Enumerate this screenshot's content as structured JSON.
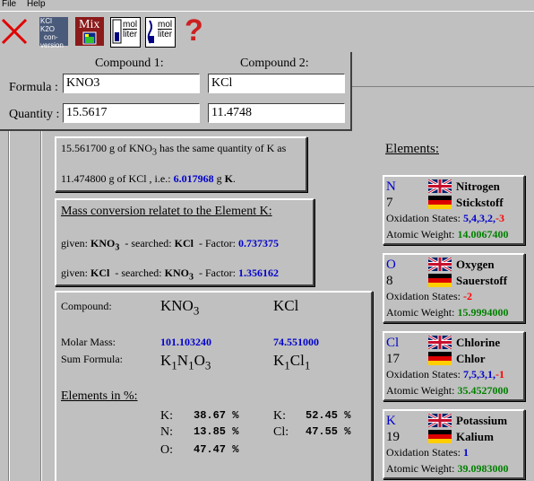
{
  "menu": {
    "file": "File",
    "help": "Help"
  },
  "toolbar": {
    "conversion_line1": "KCl",
    "conversion_line1_b": "K2O",
    "conversion_line2": "con-",
    "conversion_line3": "version",
    "mix_label": "Mix",
    "mol_label_1": "mol",
    "liter_label_1": "liter",
    "mol_label_2": "mol",
    "liter_label_2": "liter",
    "help_glyph": "?"
  },
  "input_panel": {
    "compound1_header": "Compound 1:",
    "compound2_header": "Compound 2:",
    "formula_label": "Formula :",
    "quantity_label": "Quantity :",
    "formula1": "KNO3",
    "formula2": "KCl",
    "quantity1": "15.5617",
    "quantity2": "11.4748"
  },
  "result": {
    "line1_a": "15.561700 g of KNO",
    "line1_sub": "3",
    "line1_b": " has the same quantity of K as",
    "line2_a": "11.474800 g of KCl , i.e.: ",
    "line2_value": "6.017968",
    "line2_b": " g ",
    "line2_element": "K",
    "line2_dot": "."
  },
  "mass_conversion": {
    "title": "Mass conversion relatet to the Element K:",
    "row1_given": "given: ",
    "row1_given_c": "KNO",
    "row1_given_sub": "3",
    "row1_searched": "  - searched: ",
    "row1_searched_c": "KCl",
    "row1_factor": "  - Factor: ",
    "row1_factor_v": "0.737375",
    "row2_given": "given: ",
    "row2_given_c": "KCl",
    "row2_searched": "  - searched: ",
    "row2_searched_c": "KNO",
    "row2_searched_sub": "3",
    "row2_factor": "  - Factor: ",
    "row2_factor_v": "1.356162"
  },
  "compound_details": {
    "compound_label": "Compound:",
    "c1_name": "KNO",
    "c1_sub": "3",
    "c2_name": "KCl",
    "molar_mass_label": "Molar Mass:",
    "c1_molar": "101.103240",
    "c2_molar": "74.551000",
    "sum_formula_label": "Sum Formula:",
    "c1_sum": [
      [
        "K",
        "1"
      ],
      [
        "N",
        "1"
      ],
      [
        "O",
        "3"
      ]
    ],
    "c2_sum": [
      [
        "K",
        "1"
      ],
      [
        "Cl",
        "1"
      ]
    ],
    "elements_pct_label": "Elements in %:",
    "c1_pct": [
      [
        "K:",
        "38.67 %"
      ],
      [
        "N:",
        "13.85 %"
      ],
      [
        "O:",
        "47.47 %"
      ]
    ],
    "c2_pct": [
      [
        "K:",
        "52.45 %"
      ],
      [
        "Cl:",
        "47.55 %"
      ]
    ]
  },
  "elements": {
    "title": "Elements:",
    "ox_label": "Oxidation States: ",
    "aw_label": "Atomic Weight: ",
    "items": [
      {
        "symbol": "N",
        "number": "7",
        "en": "Nitrogen",
        "de": "Stickstoff",
        "ox_pos": "5,4,3,2,",
        "ox_neg": "-3",
        "weight": "14.0067400"
      },
      {
        "symbol": "O",
        "number": "8",
        "en": "Oxygen",
        "de": "Sauerstoff",
        "ox_pos": "",
        "ox_neg": "-2",
        "weight": "15.9994000"
      },
      {
        "symbol": "Cl",
        "number": "17",
        "en": "Chlorine",
        "de": "Chlor",
        "ox_pos": "7,5,3,1,",
        "ox_neg": "-1",
        "weight": "35.4527000"
      },
      {
        "symbol": "K",
        "number": "19",
        "en": "Potassium",
        "de": "Kalium",
        "ox_pos": "1",
        "ox_neg": "",
        "weight": "39.0983000"
      }
    ]
  },
  "colors": {
    "background": "#c0c0c0",
    "value_blue": "#0000cc",
    "value_green": "#008000",
    "value_red": "#ff0000"
  }
}
